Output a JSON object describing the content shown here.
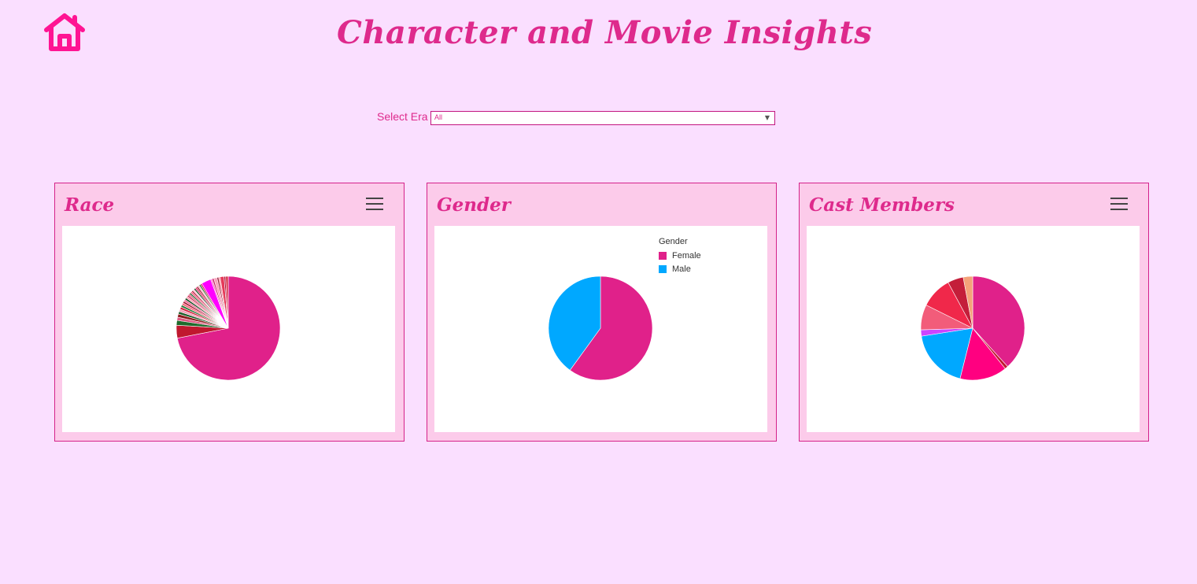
{
  "header": {
    "title": "Character and Movie Insights",
    "home_icon": "house-icon",
    "color": "#de2a8c"
  },
  "filter": {
    "label": "Select Era",
    "selected": "All"
  },
  "cards": [
    {
      "title": "Race",
      "has_menu": true
    },
    {
      "title": "Gender",
      "has_menu": false
    },
    {
      "title": "Cast Members",
      "has_menu": true
    }
  ],
  "chart_data": [
    {
      "type": "pie",
      "title": "Race",
      "values": [
        72,
        4,
        1.5,
        1,
        1,
        0.8,
        0.8,
        0.7,
        0.7,
        0.7,
        0.6,
        0.6,
        0.6,
        0.6,
        0.5,
        0.5,
        0.5,
        0.5,
        0.5,
        0.5,
        0.5,
        0.5,
        0.5,
        0.5,
        0.5,
        0.5,
        3,
        0.5,
        0.5,
        1,
        0.5,
        0.5,
        1.2,
        0.5,
        0.8
      ],
      "colors": [
        "#e0218a",
        "#c0182f",
        "#1f6b2d",
        "#e05a85",
        "#8b1a1a",
        "#1a5e2a",
        "#f4a0b8",
        "#d21f3c",
        "#2b7a3a",
        "#ff6b81",
        "#a3122e",
        "#f06292",
        "#144d22",
        "#ff9eb0",
        "#c71f4e",
        "#dd5577",
        "#1d6630",
        "#ff4f79",
        "#b71c3c",
        "#f8bbd0",
        "#0f4a1c",
        "#e91e63",
        "#9c1b2e",
        "#ffb3c6",
        "#2e7d32",
        "#d81b60",
        "#ff00ff",
        "#ff66cc",
        "#c2185b",
        "#f9a3bd",
        "#8e1431",
        "#ff8fa3",
        "#e53958",
        "#b0103a",
        "#d9384c"
      ]
    },
    {
      "type": "pie",
      "title": "Gender",
      "legend_title": "Gender",
      "categories": [
        "Female",
        "Male"
      ],
      "values": [
        60,
        40
      ],
      "colors": [
        "#e0218a",
        "#00a8ff"
      ],
      "legend": "top-right"
    },
    {
      "type": "pie",
      "title": "Cast Members",
      "values": [
        39,
        1,
        15,
        19,
        2,
        8,
        10,
        5,
        3
      ],
      "colors": [
        "#e0218a",
        "#c0182f",
        "#ff0080",
        "#00a8ff",
        "#cc44ff",
        "#f25c7a",
        "#f0284a",
        "#c41e3a",
        "#f4a279"
      ]
    }
  ]
}
